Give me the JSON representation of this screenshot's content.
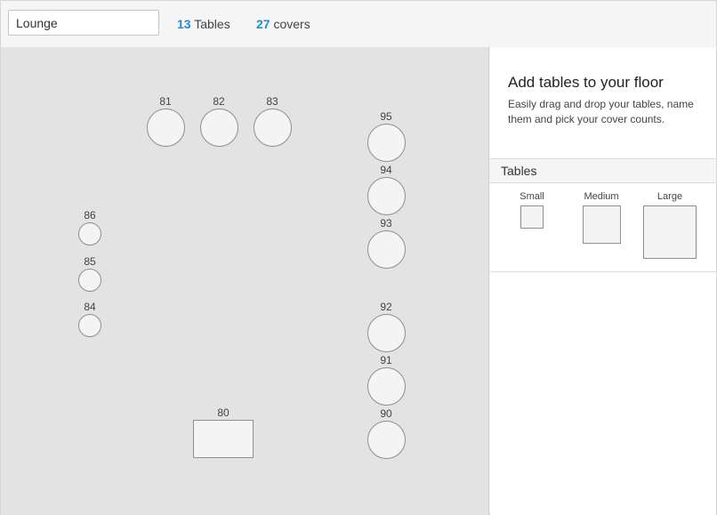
{
  "header": {
    "floor_name": "Lounge",
    "tables_count": "13",
    "tables_label": "Tables",
    "covers_count": "27",
    "covers_label": "covers"
  },
  "floor": {
    "tables": [
      {
        "label": "81"
      },
      {
        "label": "82"
      },
      {
        "label": "83"
      },
      {
        "label": "95"
      },
      {
        "label": "94"
      },
      {
        "label": "93"
      },
      {
        "label": "86"
      },
      {
        "label": "85"
      },
      {
        "label": "84"
      },
      {
        "label": "92"
      },
      {
        "label": "91"
      },
      {
        "label": "90"
      },
      {
        "label": "80"
      }
    ]
  },
  "panel": {
    "title": "Add tables to your floor",
    "description": "Easily drag and drop your tables, name them and pick your cover counts.",
    "tables_heading": "Tables",
    "sizes": [
      {
        "label": "Small"
      },
      {
        "label": "Medium"
      },
      {
        "label": "Large"
      }
    ]
  },
  "colors": {
    "accent": "#1f8dd6",
    "canvas": "#e3e3e3",
    "table_fill": "#f4f4f4",
    "table_border": "#8f8f8f"
  }
}
